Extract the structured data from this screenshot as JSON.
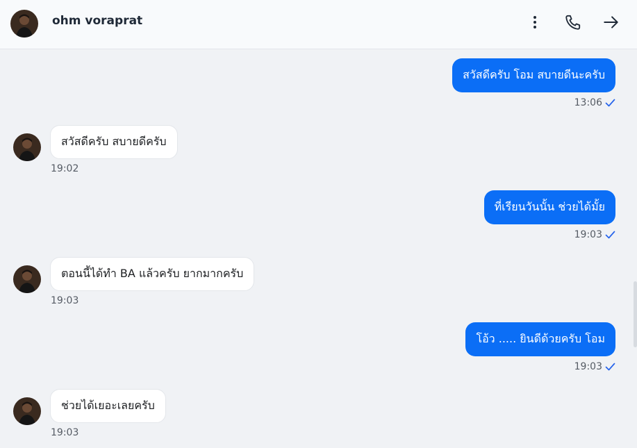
{
  "contact": {
    "name": "ohm voraprat"
  },
  "header": {
    "icons": [
      "more-vertical-icon",
      "phone-icon",
      "arrow-right-icon"
    ]
  },
  "colors": {
    "outgoing_bubble": "#0b6ef6",
    "incoming_bubble": "#ffffff",
    "background": "#f0f2f5",
    "check": "#2563eb"
  },
  "messages": [
    {
      "direction": "outgoing",
      "text": "สวัสดีครับ โอม สบายดีนะครับ",
      "time": "13:06",
      "read": true
    },
    {
      "direction": "incoming",
      "text": "สวัสดีครับ สบายดีครับ",
      "time": "19:02"
    },
    {
      "direction": "outgoing",
      "text": "ที่เรียนวันนั้น ช่วยได้มั้ย",
      "time": "19:03",
      "read": true
    },
    {
      "direction": "incoming",
      "text": "ตอนนี้ได้ทำ BA แล้วครับ ยากมากครับ",
      "time": "19:03"
    },
    {
      "direction": "outgoing",
      "text": "โอ้ว ..... ยินดีด้วยครับ โอม",
      "time": "19:03",
      "read": true
    },
    {
      "direction": "incoming",
      "text": "ช่วยได้เยอะเลยครับ",
      "time": "19:03"
    }
  ]
}
